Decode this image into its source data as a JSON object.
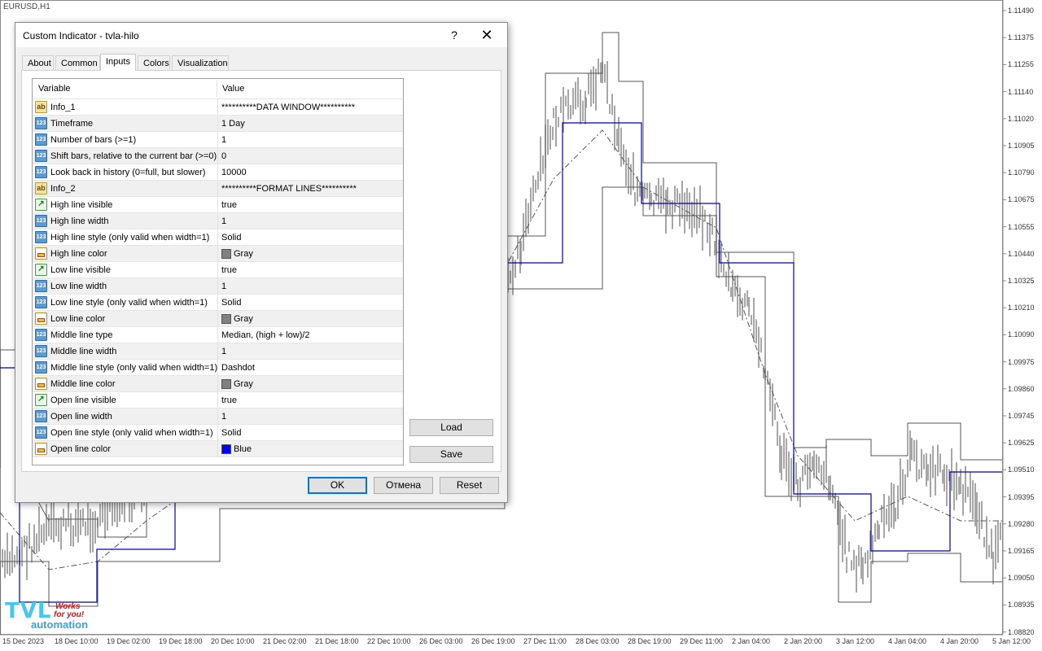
{
  "chart": {
    "title": "EURUSD,H1",
    "price_labels": [
      "1.11490",
      "1.11375",
      "1.11255",
      "1.11140",
      "1.11020",
      "1.10905",
      "1.10790",
      "1.10675",
      "1.10555",
      "1.10440",
      "1.10325",
      "1.10210",
      "1.10090",
      "1.09975",
      "1.09860",
      "1.09745",
      "1.09625",
      "1.09510",
      "1.09395",
      "1.09280",
      "1.09165",
      "1.09050",
      "1.08935",
      "1.08820"
    ],
    "time_labels": [
      "15 Dec 2023",
      "18 Dec 10:00",
      "19 Dec 02:00",
      "19 Dec 18:00",
      "20 Dec 10:00",
      "21 Dec 02:00",
      "21 Dec 18:00",
      "22 Dec 10:00",
      "26 Dec 03:00",
      "26 Dec 19:00",
      "27 Dec 11:00",
      "28 Dec 03:00",
      "28 Dec 19:00",
      "29 Dec 11:00",
      "2 Jan 04:00",
      "2 Jan 20:00",
      "3 Jan 12:00",
      "4 Jan 04:00",
      "4 Jan 20:00",
      "5 Jan 12:00"
    ],
    "colors": {
      "hilo": "#555555",
      "open_line": "#0000aa",
      "candle": "#909090"
    }
  },
  "logo": {
    "big": "TVL",
    "tag1": "Works",
    "tag2": "for you!",
    "sub": "automation"
  },
  "dialog": {
    "title": "Custom Indicator - tvla-hilo",
    "help_icon": "?",
    "close_icon": "✕",
    "tabs": [
      "About",
      "Common",
      "Inputs",
      "Colors",
      "Visualization"
    ],
    "active_tab": "Inputs",
    "header": {
      "variable": "Variable",
      "value": "Value"
    },
    "rows": [
      {
        "type": "ab",
        "variable": "Info_1",
        "value": "**********DATA WINDOW**********"
      },
      {
        "type": "num",
        "variable": "Timeframe",
        "value": "1 Day"
      },
      {
        "type": "num",
        "variable": "Number of bars (>=1)",
        "value": "1"
      },
      {
        "type": "num",
        "variable": "Shift bars, relative to the current bar (>=0)",
        "value": "0"
      },
      {
        "type": "num",
        "variable": "Look back in history (0=full, but slower)",
        "value": "10000"
      },
      {
        "type": "ab",
        "variable": "Info_2",
        "value": "**********FORMAT LINES**********"
      },
      {
        "type": "bool",
        "variable": "High line visible",
        "value": "true"
      },
      {
        "type": "num",
        "variable": "High line width",
        "value": "1"
      },
      {
        "type": "num",
        "variable": "High line style (only valid when width=1)",
        "value": "Solid"
      },
      {
        "type": "col",
        "variable": "High line color",
        "value": "Gray",
        "swatch": "#808080"
      },
      {
        "type": "bool",
        "variable": "Low line visible",
        "value": "true"
      },
      {
        "type": "num",
        "variable": "Low line width",
        "value": "1"
      },
      {
        "type": "num",
        "variable": "Low line style (only valid when width=1)",
        "value": "Solid"
      },
      {
        "type": "col",
        "variable": "Low line color",
        "value": "Gray",
        "swatch": "#808080"
      },
      {
        "type": "num",
        "variable": "Middle line type",
        "value": "Median, (high + low)/2"
      },
      {
        "type": "num",
        "variable": "Middle line width",
        "value": "1"
      },
      {
        "type": "num",
        "variable": "Middle line style (only valid when width=1)",
        "value": "Dashdot"
      },
      {
        "type": "col",
        "variable": "Middle line color",
        "value": "Gray",
        "swatch": "#808080"
      },
      {
        "type": "bool",
        "variable": "Open line visible",
        "value": "true"
      },
      {
        "type": "num",
        "variable": "Open line width",
        "value": "1"
      },
      {
        "type": "num",
        "variable": "Open line style (only valid when width=1)",
        "value": "Solid"
      },
      {
        "type": "col",
        "variable": "Open line color",
        "value": "Blue",
        "swatch": "#0000ff"
      }
    ],
    "buttons": {
      "load": "Load",
      "save": "Save",
      "ok": "OK",
      "cancel": "Отмена",
      "reset": "Reset"
    }
  }
}
